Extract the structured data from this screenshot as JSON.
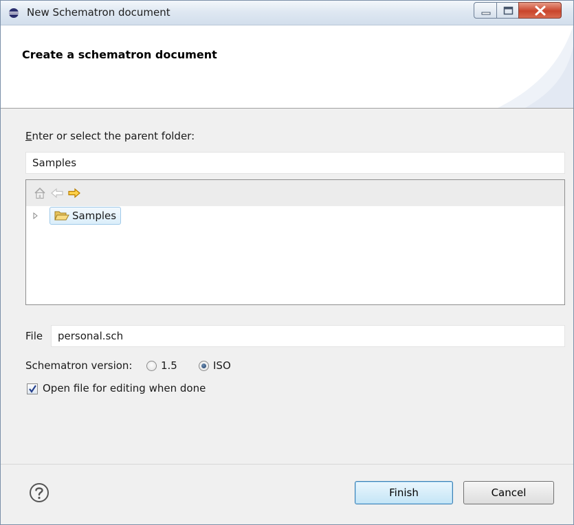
{
  "window": {
    "title": "New Schematron document",
    "controls": {
      "minimize": "minimize",
      "maximize": "maximize",
      "close": "close"
    }
  },
  "header": {
    "title": "Create a schematron document"
  },
  "folder_section": {
    "label_first_letter": "E",
    "label_rest": "nter or select the parent folder:",
    "folder_value": "Samples",
    "toolbar_icons": [
      "home-icon",
      "back-arrow-icon",
      "forward-arrow-icon"
    ],
    "tree_items": [
      {
        "label": "Samples",
        "icon": "open-folder-icon",
        "selected": true,
        "expandable": true
      }
    ]
  },
  "file": {
    "label": "File",
    "value": "personal.sch"
  },
  "version": {
    "label": "Schematron version:",
    "options": [
      {
        "label": "1.5",
        "checked": false
      },
      {
        "label": "ISO",
        "checked": true
      }
    ]
  },
  "open_file": {
    "label": "Open file for editing when done",
    "checked": true
  },
  "footer": {
    "help_icon": "help-icon",
    "finish_label": "Finish",
    "cancel_label": "Cancel"
  },
  "colors": {
    "title_bar": "#dfe8f2",
    "dialog_bg": "#f0f0f0",
    "selection_border": "#9fc9e9",
    "default_button_border": "#3c7fb1",
    "close_button": "#c9452c"
  }
}
